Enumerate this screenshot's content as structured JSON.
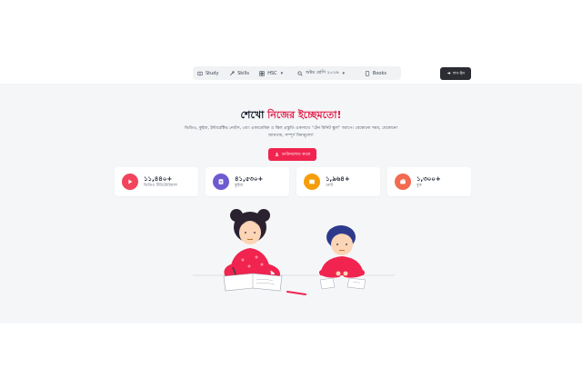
{
  "nav": {
    "items": [
      {
        "label": "Study",
        "icon": "book-open-icon"
      },
      {
        "label": "Skills",
        "icon": "tools-icon"
      },
      {
        "label": "HSC",
        "icon": "grid-icon",
        "dropdown": true
      },
      {
        "label": "অষ্টম শ্রেণি ২০২৬",
        "icon": "search-icon",
        "dropdown": true
      },
      {
        "label": "Books",
        "icon": "book-icon"
      }
    ],
    "login_label": "লগ-ইন"
  },
  "hero": {
    "title_plain": "শেখো ",
    "title_accent": "নিজের ইচ্ছেমতো!",
    "subtitle": "ভিডিও, কুইজ, ইন্টারেক্টিভ নোটস, এবং একাডেমিক ও স্কিল প্রস্তুতি একসাথে “টেন মিনিট স্কুল” অ্যাপে। যেকোনো সময়, যেকোনো জায়গায়, সম্পূর্ণ বিনামূল্যে!",
    "download_label": "ডাউনলোড করো"
  },
  "stats": [
    {
      "number": "১১,৪৪০+",
      "label": "ভিডিও টিউটোরিয়াল",
      "icon": "play-icon",
      "color": "#f2445c"
    },
    {
      "number": "৪১,৫৩০+",
      "label": "কুইজ",
      "icon": "quiz-icon",
      "color": "#6d5bd0"
    },
    {
      "number": "১,৯৬৪+",
      "label": "নোট",
      "icon": "notes-icon",
      "color": "#f59e0b"
    },
    {
      "number": "১,৩০০+",
      "label": "বুক",
      "icon": "book-stack-icon",
      "color": "#f26a4f"
    }
  ],
  "colors": {
    "accent": "#e11d48",
    "button": "#f0244f",
    "login": "#2b2d33",
    "hero_bg": "#f5f6f8"
  }
}
